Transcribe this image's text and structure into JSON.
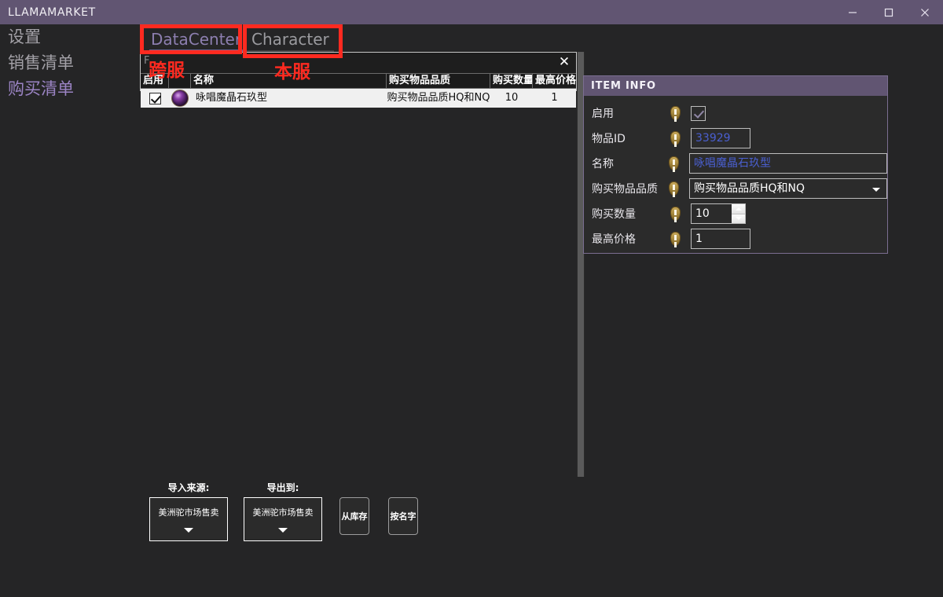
{
  "window": {
    "title": "LLAMAMARKET",
    "controls": [
      {
        "name": "minimize",
        "glyph": "minimize-icon"
      },
      {
        "name": "maximize",
        "glyph": "maximize-icon"
      },
      {
        "name": "close",
        "glyph": "close-icon"
      }
    ]
  },
  "colors": {
    "titlebar": "#615572",
    "accent": "#8d7fb0",
    "panel_header": "#615572",
    "annotation_red": "#ff2a20",
    "field_text_blue": "#4a5fd0",
    "background": "#252526"
  },
  "sidebar": {
    "items": [
      {
        "label": "设置",
        "active": false
      },
      {
        "label": "销售清单",
        "active": false
      },
      {
        "label": "购买清单",
        "active": true
      }
    ]
  },
  "tabs": [
    {
      "label": "DataCenter",
      "active": true
    },
    {
      "label": "Character",
      "active": false
    }
  ],
  "list_panel": {
    "partial_label": "F",
    "close_glyph": "✕"
  },
  "table": {
    "columns": [
      {
        "key": "enable",
        "label": "启用"
      },
      {
        "key": "icon",
        "label": ""
      },
      {
        "key": "name",
        "label": "名称"
      },
      {
        "key": "quality",
        "label": "购买物品品质"
      },
      {
        "key": "quantity",
        "label": "购买数量"
      },
      {
        "key": "max_price",
        "label": "最高价格"
      }
    ],
    "rows": [
      {
        "enable": true,
        "icon": "item-orb-icon",
        "name": "咏唱魔晶石玖型",
        "quality": "购买物品品质HQ和NQ",
        "quantity": "10",
        "max_price": "1"
      }
    ]
  },
  "item_info": {
    "header": "ITEM INFO",
    "fields": [
      {
        "label": "启用",
        "type": "checkbox",
        "value": "checked"
      },
      {
        "label": "物品ID",
        "type": "text",
        "value": "33929"
      },
      {
        "label": "名称",
        "type": "text",
        "value": "咏唱魔晶石玖型"
      },
      {
        "label": "购买物品品质",
        "type": "select",
        "value": "购买物品品质HQ和NQ"
      },
      {
        "label": "购买数量",
        "type": "spinner",
        "value": "10"
      },
      {
        "label": "最高价格",
        "type": "text",
        "value": "1"
      }
    ]
  },
  "bottom": {
    "import": {
      "label": "导入来源:",
      "value": "美洲驼市场售卖"
    },
    "export": {
      "label": "导出到:",
      "value": "美洲驼市场售卖"
    },
    "buttons": [
      {
        "label": "从库存"
      },
      {
        "label": "按名字"
      }
    ]
  },
  "annotations": [
    {
      "text": "跨服",
      "for": "DataCenter"
    },
    {
      "text": "本服",
      "for": "Character"
    }
  ]
}
